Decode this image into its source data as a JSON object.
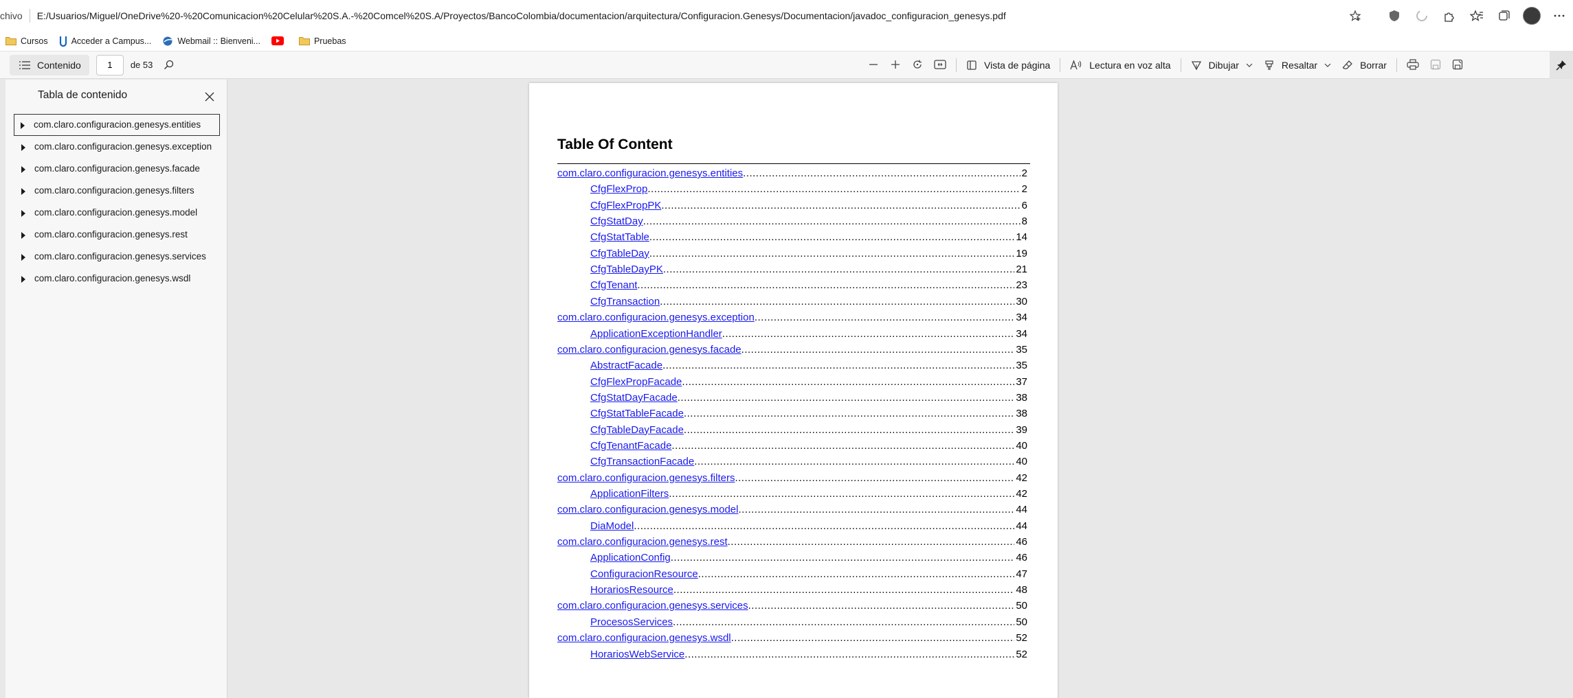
{
  "address_bar": {
    "scheme_fragment": "chivo",
    "url": "E:/Usuarios/Miguel/OneDrive%20-%20Comunicacion%20Celular%20S.A.-%20Comcel%20S.A/Proyectos/BancoColombia/documentacion/arquitectura/Configuracion.Genesys/Documentacion/javadoc_configuracion_genesys.pdf",
    "icons": [
      "favorite-add-icon",
      "shield-extension-icon",
      "loading-extension-icon",
      "extensions-icon",
      "favorites-icon",
      "collections-icon",
      "profile-avatar",
      "more-icon"
    ]
  },
  "bookmarks": [
    {
      "label": "Cursos",
      "icon": "folder-icon"
    },
    {
      "label": "Acceder a Campus...",
      "icon": "campus-icon"
    },
    {
      "label": "Webmail :: Bienveni...",
      "icon": "webmail-icon"
    },
    {
      "label": "",
      "icon": "youtube-icon"
    },
    {
      "label": "Pruebas",
      "icon": "folder-icon"
    }
  ],
  "toolbar": {
    "contents_label": "Contenido",
    "page_current": "1",
    "page_total": "de 53",
    "page_view_label": "Vista de página",
    "read_aloud_label": "Lectura en voz alta",
    "draw_label": "Dibujar",
    "highlight_label": "Resaltar",
    "erase_label": "Borrar"
  },
  "sidebar": {
    "title": "Tabla de contenido",
    "items": [
      {
        "label": "com.claro.configuracion.genesys.entities"
      },
      {
        "label": "com.claro.configuracion.genesys.exception"
      },
      {
        "label": "com.claro.configuracion.genesys.facade"
      },
      {
        "label": "com.claro.configuracion.genesys.filters"
      },
      {
        "label": "com.claro.configuracion.genesys.model"
      },
      {
        "label": "com.claro.configuracion.genesys.rest"
      },
      {
        "label": "com.claro.configuracion.genesys.services"
      },
      {
        "label": "com.claro.configuracion.genesys.wsdl"
      }
    ]
  },
  "document": {
    "title": "Table Of Content",
    "entries": [
      {
        "text": "com.claro.configuracion.genesys.entities",
        "page": "2",
        "level": 0
      },
      {
        "text": "CfgFlexProp",
        "page": "2",
        "level": 1
      },
      {
        "text": "CfgFlexPropPK",
        "page": "6",
        "level": 1
      },
      {
        "text": "CfgStatDay",
        "page": "8",
        "level": 1
      },
      {
        "text": "CfgStatTable",
        "page": "14",
        "level": 1
      },
      {
        "text": "CfgTableDay",
        "page": "19",
        "level": 1
      },
      {
        "text": "CfgTableDayPK",
        "page": "21",
        "level": 1
      },
      {
        "text": "CfgTenant",
        "page": "23",
        "level": 1
      },
      {
        "text": "CfgTransaction",
        "page": "30",
        "level": 1
      },
      {
        "text": "com.claro.configuracion.genesys.exception",
        "page": "34",
        "level": 0
      },
      {
        "text": "ApplicationExceptionHandler",
        "page": "34",
        "level": 1
      },
      {
        "text": "com.claro.configuracion.genesys.facade",
        "page": "35",
        "level": 0
      },
      {
        "text": "AbstractFacade",
        "page": "35",
        "level": 1
      },
      {
        "text": "CfgFlexPropFacade",
        "page": "37",
        "level": 1
      },
      {
        "text": "CfgStatDayFacade",
        "page": "38",
        "level": 1
      },
      {
        "text": "CfgStatTableFacade",
        "page": "38",
        "level": 1
      },
      {
        "text": "CfgTableDayFacade",
        "page": "39",
        "level": 1
      },
      {
        "text": "CfgTenantFacade",
        "page": "40",
        "level": 1
      },
      {
        "text": "CfgTransactionFacade",
        "page": "40",
        "level": 1
      },
      {
        "text": "com.claro.configuracion.genesys.filters",
        "page": "42",
        "level": 0
      },
      {
        "text": "ApplicationFilters",
        "page": "42",
        "level": 1
      },
      {
        "text": "com.claro.configuracion.genesys.model",
        "page": "44",
        "level": 0
      },
      {
        "text": "DiaModel",
        "page": "44",
        "level": 1
      },
      {
        "text": "com.claro.configuracion.genesys.rest",
        "page": "46",
        "level": 0
      },
      {
        "text": "ApplicationConfig",
        "page": "46",
        "level": 1
      },
      {
        "text": "ConfiguracionResource",
        "page": "47",
        "level": 1
      },
      {
        "text": "HorariosResource",
        "page": "48",
        "level": 1
      },
      {
        "text": "com.claro.configuracion.genesys.services",
        "page": "50",
        "level": 0
      },
      {
        "text": "ProcesosServices",
        "page": "50",
        "level": 1
      },
      {
        "text": "com.claro.configuracion.genesys.wsdl",
        "page": "52",
        "level": 0
      },
      {
        "text": "HorariosWebService",
        "page": "52",
        "level": 1
      }
    ]
  },
  "colors": {
    "link": "#1a1aee",
    "youtube": "#ff0000",
    "folder": "#e8b43a"
  }
}
